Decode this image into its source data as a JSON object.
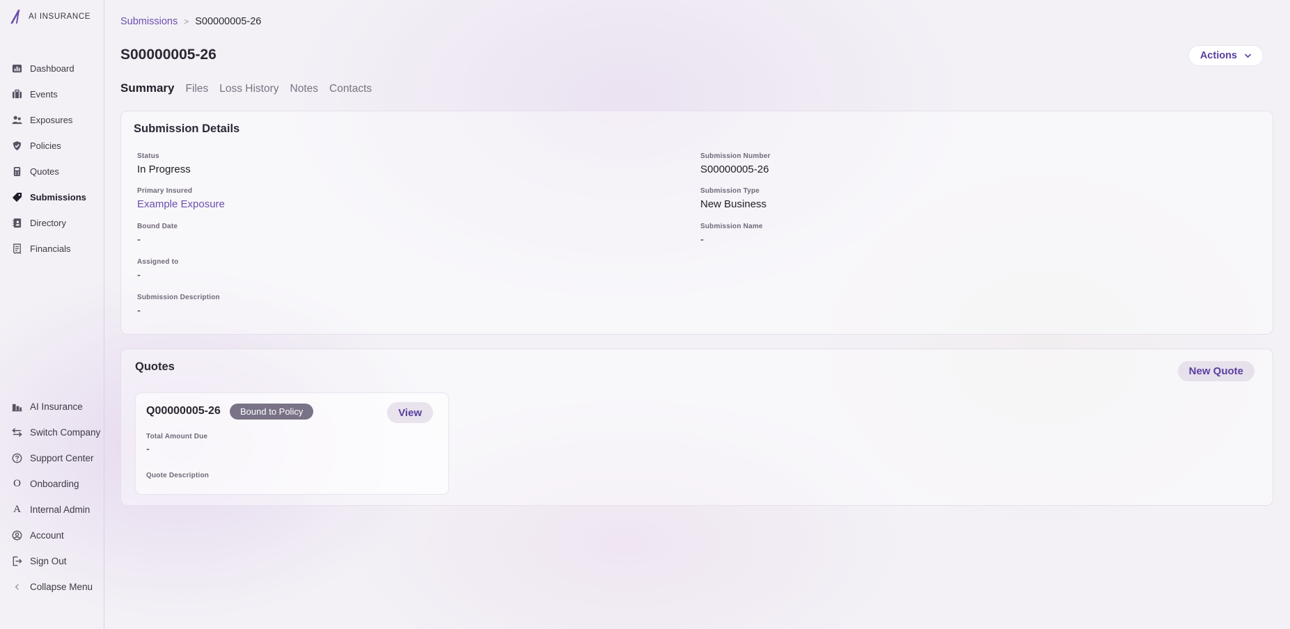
{
  "brand": {
    "name": "AI INSURANCE",
    "accent": "#6c4fae"
  },
  "sidebar": {
    "items": [
      {
        "label": "Dashboard",
        "icon": "chart-icon"
      },
      {
        "label": "Events",
        "icon": "briefcase-icon"
      },
      {
        "label": "Exposures",
        "icon": "users-icon"
      },
      {
        "label": "Policies",
        "icon": "shield-icon"
      },
      {
        "label": "Quotes",
        "icon": "calculator-icon"
      },
      {
        "label": "Submissions",
        "icon": "tag-icon",
        "active": true
      },
      {
        "label": "Directory",
        "icon": "address-book-icon"
      },
      {
        "label": "Financials",
        "icon": "receipt-icon"
      }
    ],
    "bottom_items": [
      {
        "label": "AI Insurance",
        "icon": "building-icon"
      },
      {
        "label": "Switch Company",
        "icon": "switch-icon"
      },
      {
        "label": "Support Center",
        "icon": "help-circle-icon"
      },
      {
        "label": "Onboarding",
        "icon": "letter-o-icon",
        "glyph": "O"
      },
      {
        "label": "Internal Admin",
        "icon": "letter-a-icon",
        "glyph": "A"
      },
      {
        "label": "Account",
        "icon": "user-circle-icon"
      },
      {
        "label": "Sign Out",
        "icon": "sign-out-icon"
      },
      {
        "label": "Collapse Menu",
        "icon": "chevron-left-icon"
      }
    ]
  },
  "breadcrumb": {
    "parent": "Submissions",
    "separator": ">",
    "current": "S00000005-26"
  },
  "page": {
    "title": "S00000005-26",
    "actions_label": "Actions"
  },
  "tabs": [
    "Summary",
    "Files",
    "Loss History",
    "Notes",
    "Contacts"
  ],
  "details": {
    "title": "Submission Details",
    "status_label": "Status",
    "status_value": "In Progress",
    "primary_insured_label": "Primary Insured",
    "primary_insured_value": "Example Exposure",
    "bound_date_label": "Bound Date",
    "bound_date_value": "-",
    "assigned_to_label": "Assigned to",
    "assigned_to_value": "-",
    "description_label": "Submission Description",
    "description_value": "-",
    "number_label": "Submission Number",
    "number_value": "S00000005-26",
    "type_label": "Submission Type",
    "type_value": "New Business",
    "name_label": "Submission Name",
    "name_value": "-"
  },
  "quotes": {
    "title": "Quotes",
    "new_quote_label": "New Quote",
    "items": [
      {
        "id": "Q00000005-26",
        "status": "Bound to Policy",
        "view_label": "View",
        "total_label": "Total Amount Due",
        "total_value": "-",
        "description_label": "Quote Description"
      }
    ]
  }
}
